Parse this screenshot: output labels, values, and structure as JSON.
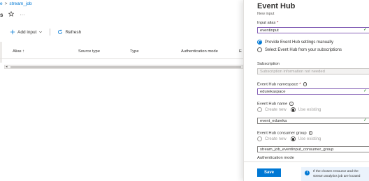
{
  "breadcrumb": {
    "first": "e",
    "separator": ">",
    "current": "stream_job"
  },
  "header": {
    "title": "s",
    "star_icon": "star-icon",
    "more": "···"
  },
  "toolbar": {
    "add_input": "Add input",
    "refresh": "Refresh"
  },
  "grid": {
    "columns": [
      "Alias ↑",
      "Source type",
      "Type",
      "Authentication mode",
      "E"
    ]
  },
  "blade": {
    "title": "Event Hub",
    "subtitle": "New input",
    "input_alias_label": "Input alias",
    "input_alias_value": "eventinput",
    "option_manual": "Provide Event Hub settings manually",
    "option_subscription": "Select Event Hub from your subscriptions",
    "subscription_label": "Subscription",
    "subscription_value": "Subscription information not needed",
    "namespace_label": "Event Hub namespace",
    "namespace_value": "edurekaspace",
    "hubname_label": "Event Hub name",
    "create_new": "Create new",
    "use_existing": "Use existing",
    "hubname_value": "event_edureka",
    "consumer_group_label": "Event Hub consumer group",
    "consumer_group_value": "stream_job_eventinput_consumer_group",
    "cut_label": "Authentication mode",
    "save": "Save",
    "notice": "If the chosen resource and the stream analytics job are located"
  },
  "colors": {
    "accent": "#0078d4",
    "focus": "#8764b8",
    "valid": "#107c10"
  }
}
